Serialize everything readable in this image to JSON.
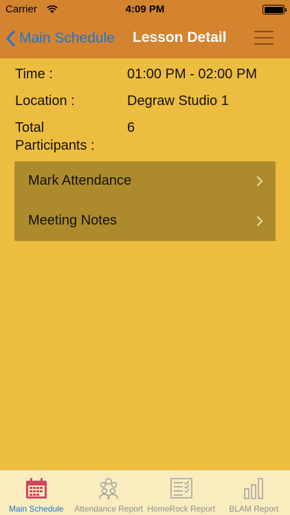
{
  "status_bar": {
    "carrier": "Carrier",
    "time": "4:09 PM",
    "wifi_icon": "wifi-icon",
    "battery_icon": "battery-full-icon"
  },
  "nav": {
    "back_label": "Main Schedule",
    "title": "Lesson Detail",
    "menu_icon": "hamburger-menu-icon"
  },
  "details": {
    "time_label": "Time :",
    "time_value": "01:00 PM - 02:00 PM",
    "location_label": "Location :",
    "location_value": "Degraw Studio 1",
    "participants_label_line1": "Total",
    "participants_label_line2": "Participants :",
    "participants_value": "6"
  },
  "actions": [
    {
      "label": "Mark Attendance",
      "icon": "chevron-right-icon"
    },
    {
      "label": "Meeting Notes",
      "icon": "chevron-right-icon"
    }
  ],
  "tabs": [
    {
      "label": "Main Schedule",
      "icon": "calendar-icon",
      "active": true
    },
    {
      "label": "Attendance Report",
      "icon": "group-icon",
      "active": false
    },
    {
      "label": "HomeRock Report",
      "icon": "checklist-icon",
      "active": false
    },
    {
      "label": "BLAM Report",
      "icon": "bar-chart-icon",
      "active": false
    }
  ],
  "colors": {
    "background": "#edbd40",
    "nav_bar": "#d4832e",
    "action_list": "#ad8b2c",
    "tab_bar": "#f9edc0",
    "accent_blue": "#1c74d9",
    "calendar_active": "#d0465f"
  }
}
